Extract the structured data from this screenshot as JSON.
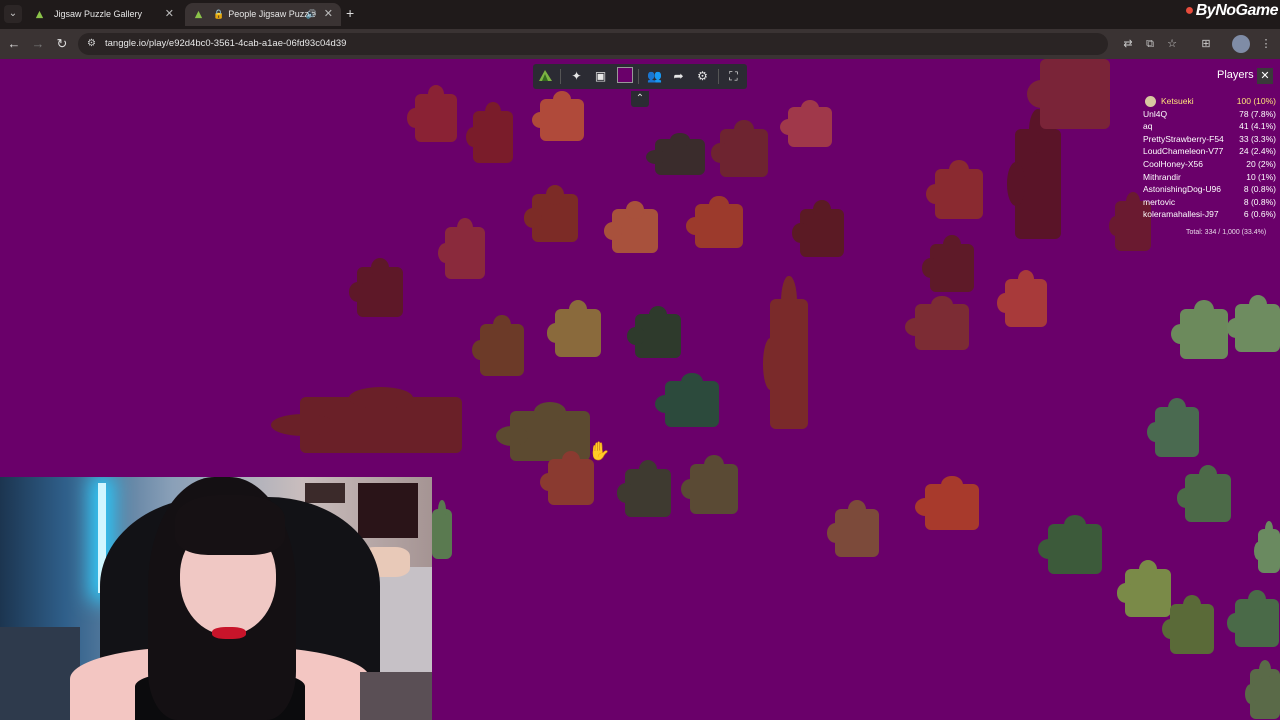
{
  "browser": {
    "tabs": [
      {
        "label": "Jigsaw Puzzle Gallery",
        "active": false
      },
      {
        "label": "People Jigsaw Puzzle",
        "active": true
      }
    ],
    "url": "tanggle.io/play/e92d4bc0-3561-4cab-a1ae-06fd93c04d39"
  },
  "watermark": "ByNoGame",
  "canvas": {
    "background": "#6a006a"
  },
  "toolbar": {
    "tools": [
      "logo-icon",
      "puzzle-piece-icon",
      "image-preview-icon",
      "background-color-swatch",
      "players-icon",
      "share-icon",
      "settings-icon",
      "fullscreen-icon"
    ],
    "collapse_icon": "chevrons-up-icon"
  },
  "players": {
    "title": "Players",
    "list": [
      {
        "name": "Ketsueki",
        "score": "100 (10%)",
        "me": true
      },
      {
        "name": "Unl4Q",
        "score": "78 (7.8%)"
      },
      {
        "name": "aq",
        "score": "41 (4.1%)"
      },
      {
        "name": "PrettyStrawberry-F54",
        "score": "33 (3.3%)"
      },
      {
        "name": "LoudChameleon-V77",
        "score": "24 (2.4%)"
      },
      {
        "name": "CoolHoney-X56",
        "score": "20 (2%)"
      },
      {
        "name": "Mithrandir",
        "score": "10 (1%)"
      },
      {
        "name": "AstonishingDog-U96",
        "score": "8 (0.8%)"
      },
      {
        "name": "mertovic",
        "score": "8 (0.8%)"
      },
      {
        "name": "koleramahallesi-J97",
        "score": "6 (0.6%)"
      }
    ],
    "total": "Total: 334 / 1,000 (33.4%)"
  },
  "colors": {
    "accent_me": "#ffe27a",
    "toolbar_bg": "#2b2b33"
  }
}
